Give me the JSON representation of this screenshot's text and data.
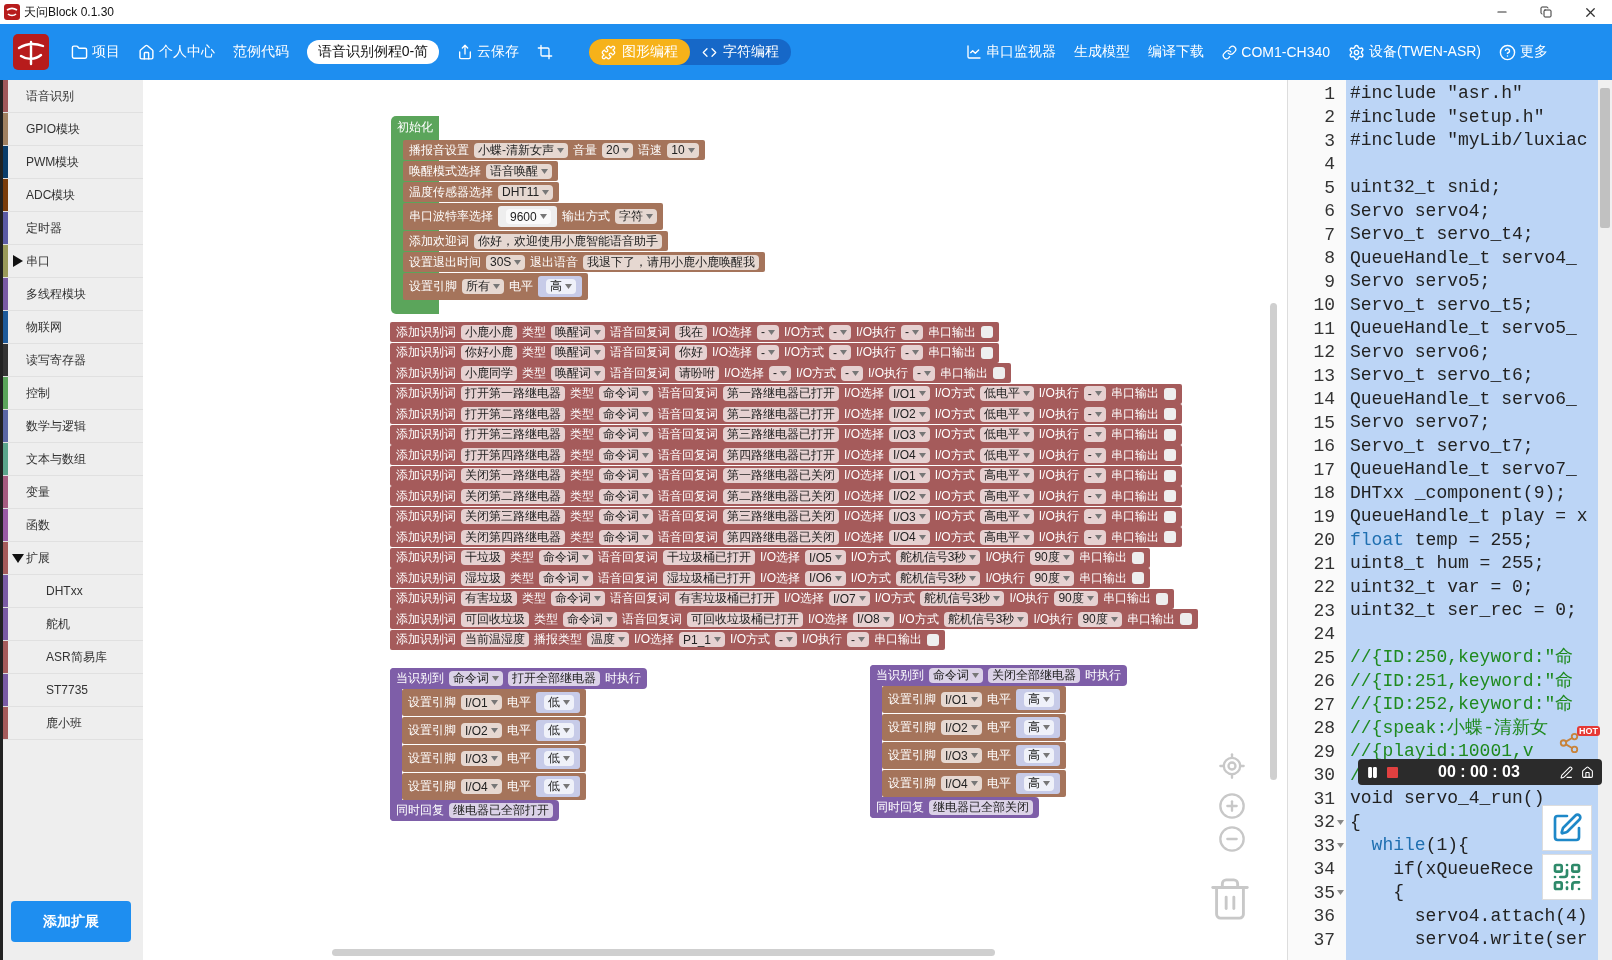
{
  "window": {
    "title": "天问Block 0.1.30"
  },
  "toolbar": {
    "project": "项目",
    "personal_center": "个人中心",
    "examples": "范例代码",
    "project_name": "语音识别例程0-简",
    "cloud_save": "云保存",
    "modes": [
      {
        "kind": "graphic",
        "label": "图形编程",
        "selected": true
      },
      {
        "kind": "text",
        "label": "字符编程",
        "selected": false
      }
    ],
    "serial_monitor": "串口监视器",
    "generate_model": "生成模型",
    "compile_download": "编译下载",
    "port": "COM1-CH340",
    "device": "设备(TWEN-ASR)",
    "more": "更多"
  },
  "sidebar": {
    "items": [
      {
        "kind": "category",
        "label": "语音识别",
        "color": "#a0585a"
      },
      {
        "kind": "category",
        "label": "GPIO模块",
        "color": "#a08060"
      },
      {
        "kind": "category",
        "label": "PWM模块",
        "color": "#0a3d6b"
      },
      {
        "kind": "category",
        "label": "ADC模块",
        "color": "#7a3c0a"
      },
      {
        "kind": "category",
        "label": "定时器",
        "color": "#5b5ba5"
      },
      {
        "kind": "group",
        "label": "串口",
        "color": "#9a9a5a",
        "expanded": false
      },
      {
        "kind": "category",
        "label": "多线程模块",
        "color": "#7a5ba5"
      },
      {
        "kind": "category",
        "label": "物联网",
        "color": "#1e5a9a"
      },
      {
        "kind": "category",
        "label": "读写寄存器",
        "color": "#333333"
      },
      {
        "kind": "category",
        "label": "控制",
        "color": "#5ba55b"
      },
      {
        "kind": "category",
        "label": "数学与逻辑",
        "color": "#5b67a5"
      },
      {
        "kind": "category",
        "label": "文本与数组",
        "color": "#5ba58c"
      },
      {
        "kind": "category",
        "label": "变量",
        "color": "#a55b80"
      },
      {
        "kind": "category",
        "label": "函数",
        "color": "#995ba5"
      },
      {
        "kind": "group",
        "label": "扩展",
        "color": "#a55b5b",
        "expanded": true,
        "children": [
          {
            "kind": "category",
            "label": "DHTxx",
            "color": "#7a5ba5"
          },
          {
            "kind": "category",
            "label": "舵机",
            "color": "#7a5ba5"
          },
          {
            "kind": "category",
            "label": "ASR简易库",
            "color": "#a55b5b"
          },
          {
            "kind": "category",
            "label": "ST7735",
            "color": "#7a5ba5"
          },
          {
            "kind": "category",
            "label": "鹿小班",
            "color": "#a55b5b"
          }
        ]
      }
    ],
    "add_button": "添加扩展"
  },
  "workspace": {
    "init_block": {
      "title": "初始化",
      "statements": [
        {
          "parts": [
            {
              "kind": "label",
              "text": "播报音设置"
            },
            {
              "kind": "dropdown",
              "text": "小蝶-清新女声"
            },
            {
              "kind": "label",
              "text": "音量"
            },
            {
              "kind": "dropdown",
              "text": "20"
            },
            {
              "kind": "label",
              "text": "语速"
            },
            {
              "kind": "dropdown",
              "text": "10"
            }
          ]
        },
        {
          "parts": [
            {
              "kind": "label",
              "text": "唤醒模式选择"
            },
            {
              "kind": "dropdown",
              "text": "语音唤醒"
            }
          ]
        },
        {
          "parts": [
            {
              "kind": "label",
              "text": "温度传感器选择"
            },
            {
              "kind": "dropdown",
              "text": "DHT11"
            }
          ]
        },
        {
          "parts": [
            {
              "kind": "label",
              "text": "串口波特率选择"
            },
            {
              "kind": "socket",
              "text": "9600",
              "color": "#eeeeee"
            },
            {
              "kind": "label",
              "text": "输出方式"
            },
            {
              "kind": "dropdown",
              "text": "字符"
            }
          ]
        },
        {
          "parts": [
            {
              "kind": "label",
              "text": "添加欢迎词"
            },
            {
              "kind": "input",
              "text": "你好，欢迎使用小鹿智能语音助手"
            }
          ]
        },
        {
          "parts": [
            {
              "kind": "label",
              "text": "设置退出时间"
            },
            {
              "kind": "dropdown",
              "text": "30S"
            },
            {
              "kind": "label",
              "text": "退出语音"
            },
            {
              "kind": "input",
              "text": "我退下了，请用小鹿小鹿唤醒我"
            }
          ]
        },
        {
          "parts": [
            {
              "kind": "label",
              "text": "设置引脚"
            },
            {
              "kind": "dropdown",
              "text": "所有"
            },
            {
              "kind": "label",
              "text": "电平"
            },
            {
              "kind": "socket",
              "text": "高",
              "color": "#c7cbe8"
            }
          ]
        }
      ]
    },
    "word_blocks": [
      {
        "parts": [
          {
            "kind": "label",
            "text": "添加识别词"
          },
          {
            "kind": "input",
            "text": "小鹿小鹿"
          },
          {
            "kind": "label",
            "text": "类型"
          },
          {
            "kind": "dropdown",
            "text": "唤醒词"
          },
          {
            "kind": "label",
            "text": "语音回复词"
          },
          {
            "kind": "input",
            "text": "我在"
          },
          {
            "kind": "label",
            "text": "I/O选择"
          },
          {
            "kind": "dropdown",
            "text": "-"
          },
          {
            "kind": "label",
            "text": "I/O方式"
          },
          {
            "kind": "dropdown",
            "text": "-"
          },
          {
            "kind": "label",
            "text": "I/O执行"
          },
          {
            "kind": "dropdown",
            "text": "-"
          },
          {
            "kind": "label",
            "text": "串口输出"
          },
          {
            "kind": "checkbox",
            "checked": false
          }
        ]
      },
      {
        "parts": [
          {
            "kind": "label",
            "text": "添加识别词"
          },
          {
            "kind": "input",
            "text": "你好小鹿"
          },
          {
            "kind": "label",
            "text": "类型"
          },
          {
            "kind": "dropdown",
            "text": "唤醒词"
          },
          {
            "kind": "label",
            "text": "语音回复词"
          },
          {
            "kind": "input",
            "text": "你好"
          },
          {
            "kind": "label",
            "text": "I/O选择"
          },
          {
            "kind": "dropdown",
            "text": "-"
          },
          {
            "kind": "label",
            "text": "I/O方式"
          },
          {
            "kind": "dropdown",
            "text": "-"
          },
          {
            "kind": "label",
            "text": "I/O执行"
          },
          {
            "kind": "dropdown",
            "text": "-"
          },
          {
            "kind": "label",
            "text": "串口输出"
          },
          {
            "kind": "checkbox",
            "checked": false
          }
        ]
      },
      {
        "parts": [
          {
            "kind": "label",
            "text": "添加识别词"
          },
          {
            "kind": "input",
            "text": "小鹿同学"
          },
          {
            "kind": "label",
            "text": "类型"
          },
          {
            "kind": "dropdown",
            "text": "唤醒词"
          },
          {
            "kind": "label",
            "text": "语音回复词"
          },
          {
            "kind": "input",
            "text": "请吩咐"
          },
          {
            "kind": "label",
            "text": "I/O选择"
          },
          {
            "kind": "dropdown",
            "text": "-"
          },
          {
            "kind": "label",
            "text": "I/O方式"
          },
          {
            "kind": "dropdown",
            "text": "-"
          },
          {
            "kind": "label",
            "text": "I/O执行"
          },
          {
            "kind": "dropdown",
            "text": "-"
          },
          {
            "kind": "label",
            "text": "串口输出"
          },
          {
            "kind": "checkbox",
            "checked": false
          }
        ]
      },
      {
        "parts": [
          {
            "kind": "label",
            "text": "添加识别词"
          },
          {
            "kind": "input",
            "text": "打开第一路继电器"
          },
          {
            "kind": "label",
            "text": "类型"
          },
          {
            "kind": "dropdown",
            "text": "命令词"
          },
          {
            "kind": "label",
            "text": "语音回复词"
          },
          {
            "kind": "input",
            "text": "第一路继电器已打开"
          },
          {
            "kind": "label",
            "text": "I/O选择"
          },
          {
            "kind": "dropdown",
            "text": "I/O1"
          },
          {
            "kind": "label",
            "text": "I/O方式"
          },
          {
            "kind": "dropdown",
            "text": "低电平"
          },
          {
            "kind": "label",
            "text": "I/O执行"
          },
          {
            "kind": "dropdown",
            "text": "-"
          },
          {
            "kind": "label",
            "text": "串口输出"
          },
          {
            "kind": "checkbox",
            "checked": false
          }
        ]
      },
      {
        "parts": [
          {
            "kind": "label",
            "text": "添加识别词"
          },
          {
            "kind": "input",
            "text": "打开第二路继电器"
          },
          {
            "kind": "label",
            "text": "类型"
          },
          {
            "kind": "dropdown",
            "text": "命令词"
          },
          {
            "kind": "label",
            "text": "语音回复词"
          },
          {
            "kind": "input",
            "text": "第二路继电器已打开"
          },
          {
            "kind": "label",
            "text": "I/O选择"
          },
          {
            "kind": "dropdown",
            "text": "I/O2"
          },
          {
            "kind": "label",
            "text": "I/O方式"
          },
          {
            "kind": "dropdown",
            "text": "低电平"
          },
          {
            "kind": "label",
            "text": "I/O执行"
          },
          {
            "kind": "dropdown",
            "text": "-"
          },
          {
            "kind": "label",
            "text": "串口输出"
          },
          {
            "kind": "checkbox",
            "checked": false
          }
        ]
      },
      {
        "parts": [
          {
            "kind": "label",
            "text": "添加识别词"
          },
          {
            "kind": "input",
            "text": "打开第三路继电器"
          },
          {
            "kind": "label",
            "text": "类型"
          },
          {
            "kind": "dropdown",
            "text": "命令词"
          },
          {
            "kind": "label",
            "text": "语音回复词"
          },
          {
            "kind": "input",
            "text": "第三路继电器已打开"
          },
          {
            "kind": "label",
            "text": "I/O选择"
          },
          {
            "kind": "dropdown",
            "text": "I/O3"
          },
          {
            "kind": "label",
            "text": "I/O方式"
          },
          {
            "kind": "dropdown",
            "text": "低电平"
          },
          {
            "kind": "label",
            "text": "I/O执行"
          },
          {
            "kind": "dropdown",
            "text": "-"
          },
          {
            "kind": "label",
            "text": "串口输出"
          },
          {
            "kind": "checkbox",
            "checked": false
          }
        ]
      },
      {
        "parts": [
          {
            "kind": "label",
            "text": "添加识别词"
          },
          {
            "kind": "input",
            "text": "打开第四路继电器"
          },
          {
            "kind": "label",
            "text": "类型"
          },
          {
            "kind": "dropdown",
            "text": "命令词"
          },
          {
            "kind": "label",
            "text": "语音回复词"
          },
          {
            "kind": "input",
            "text": "第四路继电器已打开"
          },
          {
            "kind": "label",
            "text": "I/O选择"
          },
          {
            "kind": "dropdown",
            "text": "I/O4"
          },
          {
            "kind": "label",
            "text": "I/O方式"
          },
          {
            "kind": "dropdown",
            "text": "低电平"
          },
          {
            "kind": "label",
            "text": "I/O执行"
          },
          {
            "kind": "dropdown",
            "text": "-"
          },
          {
            "kind": "label",
            "text": "串口输出"
          },
          {
            "kind": "checkbox",
            "checked": false
          }
        ]
      },
      {
        "parts": [
          {
            "kind": "label",
            "text": "添加识别词"
          },
          {
            "kind": "input",
            "text": "关闭第一路继电器"
          },
          {
            "kind": "label",
            "text": "类型"
          },
          {
            "kind": "dropdown",
            "text": "命令词"
          },
          {
            "kind": "label",
            "text": "语音回复词"
          },
          {
            "kind": "input",
            "text": "第一路继电器已关闭"
          },
          {
            "kind": "label",
            "text": "I/O选择"
          },
          {
            "kind": "dropdown",
            "text": "I/O1"
          },
          {
            "kind": "label",
            "text": "I/O方式"
          },
          {
            "kind": "dropdown",
            "text": "高电平"
          },
          {
            "kind": "label",
            "text": "I/O执行"
          },
          {
            "kind": "dropdown",
            "text": "-"
          },
          {
            "kind": "label",
            "text": "串口输出"
          },
          {
            "kind": "checkbox",
            "checked": false
          }
        ]
      },
      {
        "parts": [
          {
            "kind": "label",
            "text": "添加识别词"
          },
          {
            "kind": "input",
            "text": "关闭第二路继电器"
          },
          {
            "kind": "label",
            "text": "类型"
          },
          {
            "kind": "dropdown",
            "text": "命令词"
          },
          {
            "kind": "label",
            "text": "语音回复词"
          },
          {
            "kind": "input",
            "text": "第二路继电器已关闭"
          },
          {
            "kind": "label",
            "text": "I/O选择"
          },
          {
            "kind": "dropdown",
            "text": "I/O2"
          },
          {
            "kind": "label",
            "text": "I/O方式"
          },
          {
            "kind": "dropdown",
            "text": "高电平"
          },
          {
            "kind": "label",
            "text": "I/O执行"
          },
          {
            "kind": "dropdown",
            "text": "-"
          },
          {
            "kind": "label",
            "text": "串口输出"
          },
          {
            "kind": "checkbox",
            "checked": false
          }
        ]
      },
      {
        "parts": [
          {
            "kind": "label",
            "text": "添加识别词"
          },
          {
            "kind": "input",
            "text": "关闭第三路继电器"
          },
          {
            "kind": "label",
            "text": "类型"
          },
          {
            "kind": "dropdown",
            "text": "命令词"
          },
          {
            "kind": "label",
            "text": "语音回复词"
          },
          {
            "kind": "input",
            "text": "第三路继电器已关闭"
          },
          {
            "kind": "label",
            "text": "I/O选择"
          },
          {
            "kind": "dropdown",
            "text": "I/O3"
          },
          {
            "kind": "label",
            "text": "I/O方式"
          },
          {
            "kind": "dropdown",
            "text": "高电平"
          },
          {
            "kind": "label",
            "text": "I/O执行"
          },
          {
            "kind": "dropdown",
            "text": "-"
          },
          {
            "kind": "label",
            "text": "串口输出"
          },
          {
            "kind": "checkbox",
            "checked": false
          }
        ]
      },
      {
        "parts": [
          {
            "kind": "label",
            "text": "添加识别词"
          },
          {
            "kind": "input",
            "text": "关闭第四路继电器"
          },
          {
            "kind": "label",
            "text": "类型"
          },
          {
            "kind": "dropdown",
            "text": "命令词"
          },
          {
            "kind": "label",
            "text": "语音回复词"
          },
          {
            "kind": "input",
            "text": "第四路继电器已关闭"
          },
          {
            "kind": "label",
            "text": "I/O选择"
          },
          {
            "kind": "dropdown",
            "text": "I/O4"
          },
          {
            "kind": "label",
            "text": "I/O方式"
          },
          {
            "kind": "dropdown",
            "text": "高电平"
          },
          {
            "kind": "label",
            "text": "I/O执行"
          },
          {
            "kind": "dropdown",
            "text": "-"
          },
          {
            "kind": "label",
            "text": "串口输出"
          },
          {
            "kind": "checkbox",
            "checked": false
          }
        ]
      },
      {
        "parts": [
          {
            "kind": "label",
            "text": "添加识别词"
          },
          {
            "kind": "input",
            "text": "干垃圾"
          },
          {
            "kind": "label",
            "text": "类型"
          },
          {
            "kind": "dropdown",
            "text": "命令词"
          },
          {
            "kind": "label",
            "text": "语音回复词"
          },
          {
            "kind": "input",
            "text": "干垃圾桶已打开"
          },
          {
            "kind": "label",
            "text": "I/O选择"
          },
          {
            "kind": "dropdown",
            "text": "I/O5"
          },
          {
            "kind": "label",
            "text": "I/O方式"
          },
          {
            "kind": "dropdown",
            "text": "舵机信号3秒"
          },
          {
            "kind": "label",
            "text": "I/O执行"
          },
          {
            "kind": "dropdown",
            "text": "90度"
          },
          {
            "kind": "label",
            "text": "串口输出"
          },
          {
            "kind": "checkbox",
            "checked": false
          }
        ]
      },
      {
        "parts": [
          {
            "kind": "label",
            "text": "添加识别词"
          },
          {
            "kind": "input",
            "text": "湿垃圾"
          },
          {
            "kind": "label",
            "text": "类型"
          },
          {
            "kind": "dropdown",
            "text": "命令词"
          },
          {
            "kind": "label",
            "text": "语音回复词"
          },
          {
            "kind": "input",
            "text": "湿垃圾桶已打开"
          },
          {
            "kind": "label",
            "text": "I/O选择"
          },
          {
            "kind": "dropdown",
            "text": "I/O6"
          },
          {
            "kind": "label",
            "text": "I/O方式"
          },
          {
            "kind": "dropdown",
            "text": "舵机信号3秒"
          },
          {
            "kind": "label",
            "text": "I/O执行"
          },
          {
            "kind": "dropdown",
            "text": "90度"
          },
          {
            "kind": "label",
            "text": "串口输出"
          },
          {
            "kind": "checkbox",
            "checked": false
          }
        ]
      },
      {
        "parts": [
          {
            "kind": "label",
            "text": "添加识别词"
          },
          {
            "kind": "input",
            "text": "有害垃圾"
          },
          {
            "kind": "label",
            "text": "类型"
          },
          {
            "kind": "dropdown",
            "text": "命令词"
          },
          {
            "kind": "label",
            "text": "语音回复词"
          },
          {
            "kind": "input",
            "text": "有害垃圾桶已打开"
          },
          {
            "kind": "label",
            "text": "I/O选择"
          },
          {
            "kind": "dropdown",
            "text": "I/O7"
          },
          {
            "kind": "label",
            "text": "I/O方式"
          },
          {
            "kind": "dropdown",
            "text": "舵机信号3秒"
          },
          {
            "kind": "label",
            "text": "I/O执行"
          },
          {
            "kind": "dropdown",
            "text": "90度"
          },
          {
            "kind": "label",
            "text": "串口输出"
          },
          {
            "kind": "checkbox",
            "checked": false
          }
        ]
      },
      {
        "parts": [
          {
            "kind": "label",
            "text": "添加识别词"
          },
          {
            "kind": "input",
            "text": "可回收垃圾"
          },
          {
            "kind": "label",
            "text": "类型"
          },
          {
            "kind": "dropdown",
            "text": "命令词"
          },
          {
            "kind": "label",
            "text": "语音回复词"
          },
          {
            "kind": "input",
            "text": "可回收垃圾桶已打开"
          },
          {
            "kind": "label",
            "text": "I/O选择"
          },
          {
            "kind": "dropdown",
            "text": "I/O8"
          },
          {
            "kind": "label",
            "text": "I/O方式"
          },
          {
            "kind": "dropdown",
            "text": "舵机信号3秒"
          },
          {
            "kind": "label",
            "text": "I/O执行"
          },
          {
            "kind": "dropdown",
            "text": "90度"
          },
          {
            "kind": "label",
            "text": "串口输出"
          },
          {
            "kind": "checkbox",
            "checked": false
          }
        ]
      },
      {
        "parts": [
          {
            "kind": "label",
            "text": "添加识别词"
          },
          {
            "kind": "input",
            "text": "当前温湿度"
          },
          {
            "kind": "label",
            "text": "播报类型"
          },
          {
            "kind": "dropdown",
            "text": "温度"
          },
          {
            "kind": "label",
            "text": "I/O选择"
          },
          {
            "kind": "dropdown",
            "text": "P1_1"
          },
          {
            "kind": "label",
            "text": "I/O方式"
          },
          {
            "kind": "dropdown",
            "text": "-"
          },
          {
            "kind": "label",
            "text": "I/O执行"
          },
          {
            "kind": "dropdown",
            "text": "-"
          },
          {
            "kind": "label",
            "text": "串口输出"
          },
          {
            "kind": "checkbox",
            "checked": false
          }
        ]
      }
    ],
    "event_blocks": [
      {
        "header": [
          {
            "kind": "label",
            "text": "当识别到"
          },
          {
            "kind": "dropdown",
            "text": "命令词"
          },
          {
            "kind": "input",
            "text": "打开全部继电器"
          },
          {
            "kind": "label",
            "text": "时执行"
          }
        ],
        "statements": [
          {
            "parts": [
              {
                "kind": "label",
                "text": "设置引脚"
              },
              {
                "kind": "dropdown",
                "text": "I/O1"
              },
              {
                "kind": "label",
                "text": "电平"
              },
              {
                "kind": "socket",
                "text": "低",
                "color": "#c7cbe8"
              }
            ]
          },
          {
            "parts": [
              {
                "kind": "label",
                "text": "设置引脚"
              },
              {
                "kind": "dropdown",
                "text": "I/O2"
              },
              {
                "kind": "label",
                "text": "电平"
              },
              {
                "kind": "socket",
                "text": "低",
                "color": "#c7cbe8"
              }
            ]
          },
          {
            "parts": [
              {
                "kind": "label",
                "text": "设置引脚"
              },
              {
                "kind": "dropdown",
                "text": "I/O3"
              },
              {
                "kind": "label",
                "text": "电平"
              },
              {
                "kind": "socket",
                "text": "低",
                "color": "#c7cbe8"
              }
            ]
          },
          {
            "parts": [
              {
                "kind": "label",
                "text": "设置引脚"
              },
              {
                "kind": "dropdown",
                "text": "I/O4"
              },
              {
                "kind": "label",
                "text": "电平"
              },
              {
                "kind": "socket",
                "text": "低",
                "color": "#c7cbe8"
              }
            ]
          }
        ],
        "footer": [
          {
            "kind": "label",
            "text": "同时回复"
          },
          {
            "kind": "input",
            "text": "继电器已全部打开"
          }
        ]
      },
      {
        "header": [
          {
            "kind": "label",
            "text": "当识别到"
          },
          {
            "kind": "dropdown",
            "text": "命令词"
          },
          {
            "kind": "input",
            "text": "关闭全部继电器"
          },
          {
            "kind": "label",
            "text": "时执行"
          }
        ],
        "statements": [
          {
            "parts": [
              {
                "kind": "label",
                "text": "设置引脚"
              },
              {
                "kind": "dropdown",
                "text": "I/O1"
              },
              {
                "kind": "label",
                "text": "电平"
              },
              {
                "kind": "socket",
                "text": "高",
                "color": "#c7cbe8"
              }
            ]
          },
          {
            "parts": [
              {
                "kind": "label",
                "text": "设置引脚"
              },
              {
                "kind": "dropdown",
                "text": "I/O2"
              },
              {
                "kind": "label",
                "text": "电平"
              },
              {
                "kind": "socket",
                "text": "高",
                "color": "#c7cbe8"
              }
            ]
          },
          {
            "parts": [
              {
                "kind": "label",
                "text": "设置引脚"
              },
              {
                "kind": "dropdown",
                "text": "I/O3"
              },
              {
                "kind": "label",
                "text": "电平"
              },
              {
                "kind": "socket",
                "text": "高",
                "color": "#c7cbe8"
              }
            ]
          },
          {
            "parts": [
              {
                "kind": "label",
                "text": "设置引脚"
              },
              {
                "kind": "dropdown",
                "text": "I/O4"
              },
              {
                "kind": "label",
                "text": "电平"
              },
              {
                "kind": "socket",
                "text": "高",
                "color": "#c7cbe8"
              }
            ]
          }
        ],
        "footer": [
          {
            "kind": "label",
            "text": "同时回复"
          },
          {
            "kind": "input",
            "text": "继电器已全部关闭"
          }
        ]
      }
    ]
  },
  "code_editor": {
    "lines": [
      {
        "number": "1",
        "fold": false,
        "tokens": [
          {
            "kind": "plain",
            "text": "#include \"asr.h\""
          }
        ]
      },
      {
        "number": "2",
        "fold": false,
        "tokens": [
          {
            "kind": "plain",
            "text": "#include \"setup.h\""
          }
        ]
      },
      {
        "number": "3",
        "fold": false,
        "tokens": [
          {
            "kind": "plain",
            "text": "#include \"myLib/luxiac"
          }
        ]
      },
      {
        "number": "4",
        "fold": false
      },
      {
        "number": "5",
        "fold": false,
        "tokens": [
          {
            "kind": "plain",
            "text": "uint32_t snid;"
          }
        ]
      },
      {
        "number": "6",
        "fold": false,
        "tokens": [
          {
            "kind": "plain",
            "text": "Servo servo4;"
          }
        ]
      },
      {
        "number": "7",
        "fold": false,
        "tokens": [
          {
            "kind": "plain",
            "text": "Servo_t servo_t4;"
          }
        ]
      },
      {
        "number": "8",
        "fold": false,
        "tokens": [
          {
            "kind": "plain",
            "text": "QueueHandle_t servo4_"
          }
        ]
      },
      {
        "number": "9",
        "fold": false,
        "tokens": [
          {
            "kind": "plain",
            "text": "Servo servo5;"
          }
        ]
      },
      {
        "number": "10",
        "fold": false,
        "tokens": [
          {
            "kind": "plain",
            "text": "Servo_t servo_t5;"
          }
        ]
      },
      {
        "number": "11",
        "fold": false,
        "tokens": [
          {
            "kind": "plain",
            "text": "QueueHandle_t servo5_"
          }
        ]
      },
      {
        "number": "12",
        "fold": false,
        "tokens": [
          {
            "kind": "plain",
            "text": "Servo servo6;"
          }
        ]
      },
      {
        "number": "13",
        "fold": false,
        "tokens": [
          {
            "kind": "plain",
            "text": "Servo_t servo_t6;"
          }
        ]
      },
      {
        "number": "14",
        "fold": false,
        "tokens": [
          {
            "kind": "plain",
            "text": "QueueHandle_t servo6_"
          }
        ]
      },
      {
        "number": "15",
        "fold": false,
        "tokens": [
          {
            "kind": "plain",
            "text": "Servo servo7;"
          }
        ]
      },
      {
        "number": "16",
        "fold": false,
        "tokens": [
          {
            "kind": "plain",
            "text": "Servo_t servo_t7;"
          }
        ]
      },
      {
        "number": "17",
        "fold": false,
        "tokens": [
          {
            "kind": "plain",
            "text": "QueueHandle_t servo7_"
          }
        ]
      },
      {
        "number": "18",
        "fold": false,
        "tokens": [
          {
            "kind": "plain",
            "text": "DHTxx _component(9);"
          }
        ]
      },
      {
        "number": "19",
        "fold": false,
        "tokens": [
          {
            "kind": "plain",
            "text": "QueueHandle_t play = x"
          }
        ]
      },
      {
        "number": "20",
        "fold": false,
        "tokens": [
          {
            "kind": "keyword",
            "text": "float"
          },
          {
            "kind": "plain",
            "text": " temp = 255;"
          }
        ]
      },
      {
        "number": "21",
        "fold": false,
        "tokens": [
          {
            "kind": "plain",
            "text": "uint8_t hum = 255;"
          }
        ]
      },
      {
        "number": "22",
        "fold": false,
        "tokens": [
          {
            "kind": "plain",
            "text": "uint32_t var = 0;"
          }
        ]
      },
      {
        "number": "23",
        "fold": false,
        "tokens": [
          {
            "kind": "plain",
            "text": "uint32_t ser_rec = 0;"
          }
        ]
      },
      {
        "number": "24",
        "fold": false
      },
      {
        "number": "25",
        "fold": false,
        "tokens": [
          {
            "kind": "comment",
            "text": "//{ID:250,keyword:\"命"
          }
        ]
      },
      {
        "number": "26",
        "fold": false,
        "tokens": [
          {
            "kind": "comment",
            "text": "//{ID:251,keyword:\"命"
          }
        ]
      },
      {
        "number": "27",
        "fold": false,
        "tokens": [
          {
            "kind": "comment",
            "text": "//{ID:252,keyword:\"命"
          }
        ]
      },
      {
        "number": "28",
        "fold": false,
        "tokens": [
          {
            "kind": "comment",
            "text": "//{speak:小蝶-清新女"
          }
        ]
      },
      {
        "number": "29",
        "fold": false,
        "tokens": [
          {
            "kind": "comment",
            "text": "//{playid:10001,v"
          }
        ]
      },
      {
        "number": "30",
        "fold": false,
        "tokens": [
          {
            "kind": "comment",
            "text": "/"
          }
        ]
      },
      {
        "number": "31",
        "fold": false,
        "tokens": [
          {
            "kind": "plain",
            "text": "void servo_4_run()"
          }
        ]
      },
      {
        "number": "32",
        "fold": true,
        "tokens": [
          {
            "kind": "plain",
            "text": "{"
          }
        ]
      },
      {
        "number": "33",
        "fold": true,
        "tokens": [
          {
            "kind": "keyword",
            "text": "  while"
          },
          {
            "kind": "plain",
            "text": "(1){"
          }
        ]
      },
      {
        "number": "34",
        "fold": false,
        "tokens": [
          {
            "kind": "plain",
            "text": "    if(xQueueRece"
          }
        ]
      },
      {
        "number": "35",
        "fold": true,
        "tokens": [
          {
            "kind": "plain",
            "text": "    {"
          }
        ]
      },
      {
        "number": "36",
        "fold": false,
        "tokens": [
          {
            "kind": "plain",
            "text": "      servo4.attach(4)"
          }
        ]
      },
      {
        "number": "37",
        "fold": false,
        "tokens": [
          {
            "kind": "plain",
            "text": "      servo4.write(ser"
          }
        ]
      }
    ]
  },
  "recorder": {
    "time": "00 : 00 : 03",
    "badge": "HOT"
  }
}
